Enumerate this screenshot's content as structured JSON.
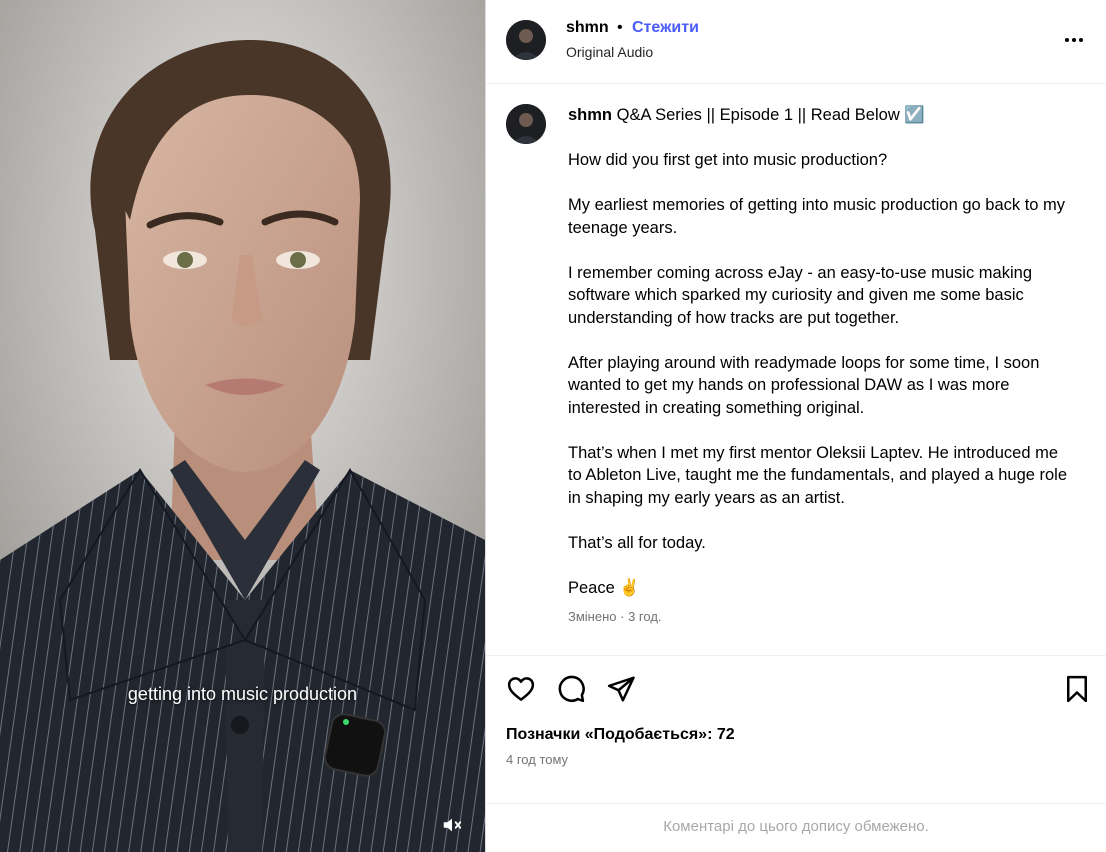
{
  "video": {
    "caption_overlay": "getting into music production",
    "mute_icon": "speaker-muted-icon"
  },
  "header": {
    "username": "shmn",
    "separator": "•",
    "follow_label": "Стежити",
    "audio_label": "Original Audio",
    "more_icon": "more-horizontal-icon"
  },
  "caption": {
    "username": "shmn",
    "title": "Q&A Series || Episode 1 || Read Below ☑️",
    "paragraphs": [
      "How did you first get into music production?",
      "My earliest memories of getting into music production go back to my teenage years.",
      "I remember coming across eJay - an easy-to-use music making software which sparked my curiosity and given me some basic understanding of how tracks are put together.",
      "After playing around with readymade loops for some time, I soon wanted to get my hands on professional DAW as I was more interested in creating something original.",
      "That’s when I met my first mentor Oleksii Laptev. He introduced me to Ableton Live, taught me the fundamentals, and played a huge role in shaping my early years as an artist.",
      "That’s all for today.",
      "Peace ✌️"
    ],
    "edited_label": "Змінено",
    "meta_separator": "·",
    "edited_time": "3 год."
  },
  "actions": {
    "icons": [
      "heart-icon",
      "comment-icon",
      "share-icon",
      "bookmark-icon"
    ],
    "likes_text": "Позначки «Подобається»: 72",
    "time_ago": "4 год тому"
  },
  "comments_disabled_text": "Коментарі до цього допису обмежено.",
  "colors": {
    "follow": "#4a5df9",
    "muted_text": "#737373",
    "disabled_text": "#a8a8a8",
    "divider": "#dbdbdb"
  }
}
